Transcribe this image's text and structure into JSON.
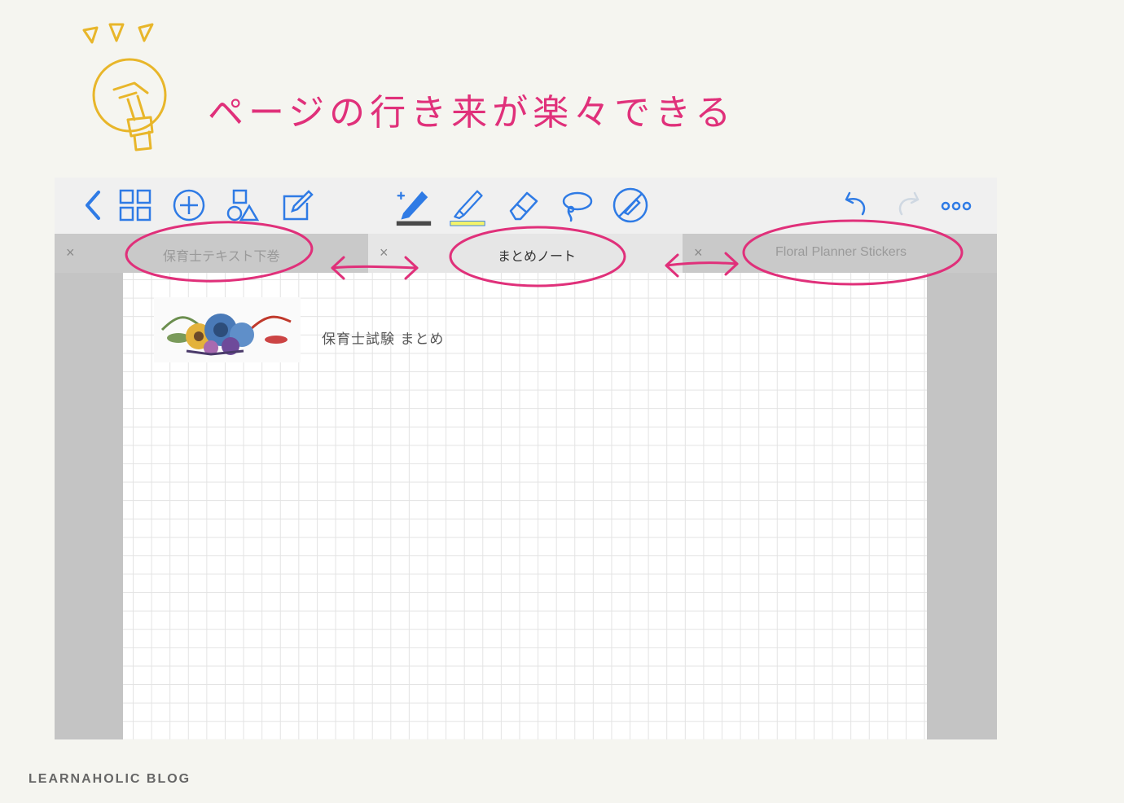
{
  "annotation": {
    "heading": "ページの行き来が楽々できる",
    "accent_color": "#e0307a"
  },
  "toolbar": {
    "left_icons": [
      "back-chevron-icon",
      "grid-icon",
      "add-page-icon",
      "shapes-icon",
      "edit-note-icon"
    ],
    "center_tools": [
      "pen-tool-icon",
      "highlighter-tool-icon",
      "eraser-tool-icon",
      "lasso-tool-icon",
      "disable-tool-icon"
    ],
    "right_icons": [
      "undo-icon",
      "redo-icon",
      "more-icon"
    ],
    "accent_color": "#2f7be5",
    "pen_color": "#4a4a4a",
    "highlighter_color": "#f3f36a"
  },
  "tabs": [
    {
      "label": "保育士テキスト下巻",
      "close": "×",
      "active": false
    },
    {
      "label": "まとめノート",
      "close": "×",
      "active": true
    },
    {
      "label": "Floral Planner Stickers",
      "close": "×",
      "active": false
    }
  ],
  "page": {
    "title": "保育士試験 まとめ"
  },
  "footer": {
    "text": "LEARNAHOLIC BLOG"
  }
}
